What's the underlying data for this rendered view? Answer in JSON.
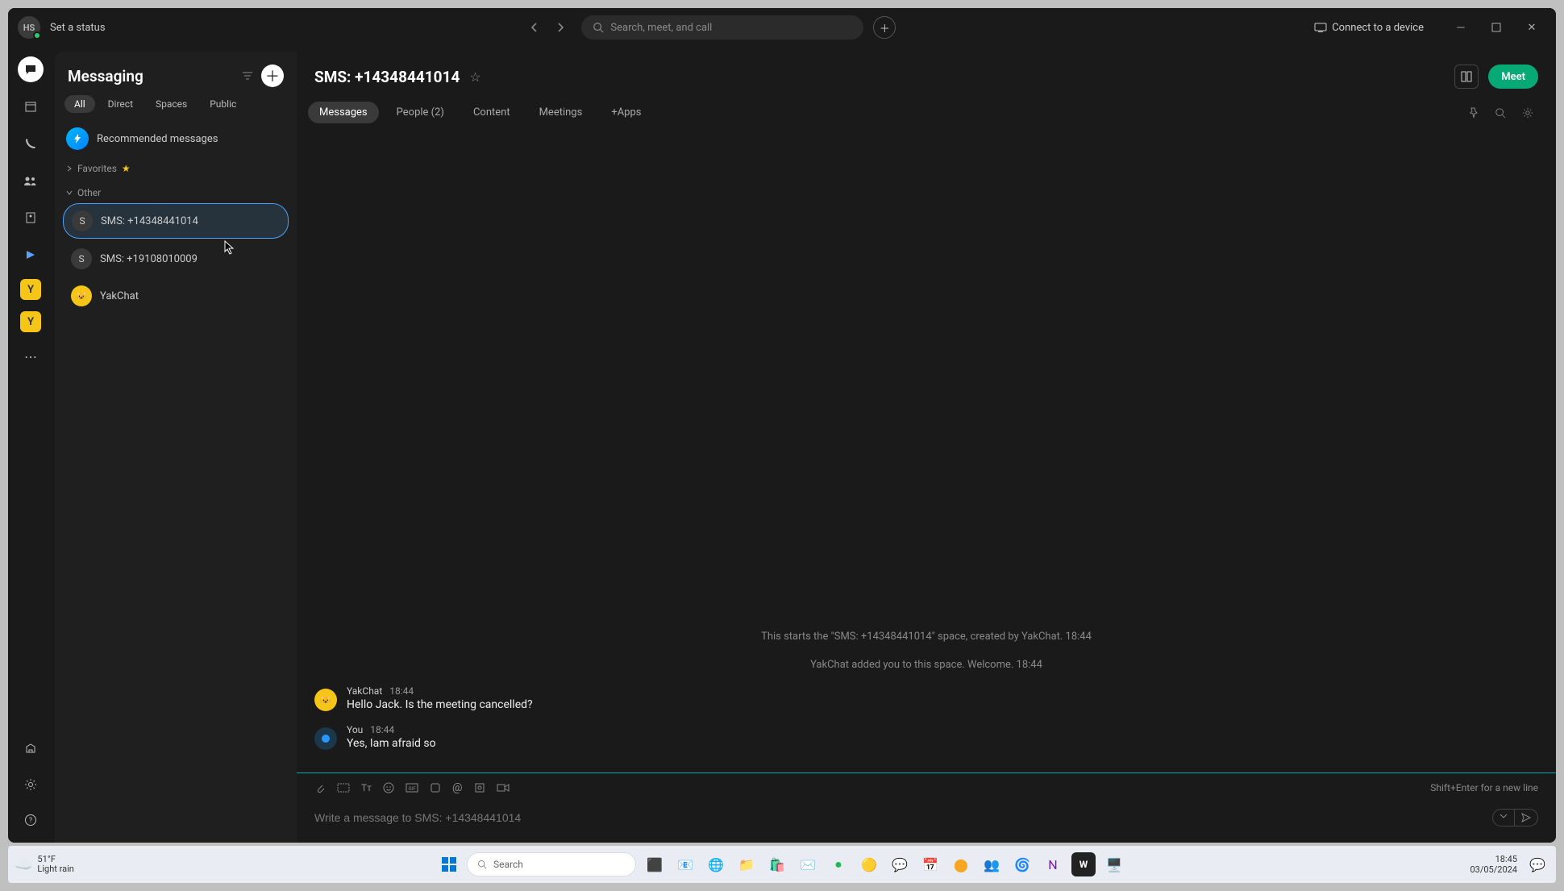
{
  "titlebar": {
    "avatar_initials": "HS",
    "status_prompt": "Set a status",
    "search_placeholder": "Search, meet, and call",
    "connect_label": "Connect to a device"
  },
  "sidebar": {
    "title": "Messaging",
    "tabs": [
      "All",
      "Direct",
      "Spaces",
      "Public"
    ],
    "active_tab_index": 0,
    "recommended_label": "Recommended messages",
    "sections": {
      "favorites_label": "Favorites",
      "other_label": "Other"
    },
    "conversations": [
      {
        "avatar": "S",
        "label": "SMS: +14348441014",
        "selected": true,
        "type": "sms"
      },
      {
        "avatar": "S",
        "label": "SMS: +19108010009",
        "selected": false,
        "type": "sms"
      },
      {
        "avatar": "Y",
        "label": "YakChat",
        "selected": false,
        "type": "yak"
      }
    ]
  },
  "main": {
    "title": "SMS: +14348441014",
    "meet_label": "Meet",
    "tabs": [
      {
        "label": "Messages",
        "active": true
      },
      {
        "label": "People (2)",
        "active": false
      },
      {
        "label": "Content",
        "active": false
      },
      {
        "label": "Meetings",
        "active": false
      },
      {
        "label": "+Apps",
        "active": false
      }
    ],
    "system_messages": [
      "This starts the \"SMS: +14348441014\" space, created by YakChat. 18:44",
      "YakChat added you to this space. Welcome. 18:44"
    ],
    "messages": [
      {
        "sender": "YakChat",
        "time": "18:44",
        "text": "Hello Jack. Is the meeting cancelled?",
        "avatar_type": "yak"
      },
      {
        "sender": "You",
        "time": "18:44",
        "text": "Yes, Iam afraid so",
        "avatar_type": "you"
      }
    ],
    "composer": {
      "hint": "Shift+Enter for a new line",
      "placeholder": "Write a message to SMS: +14348441014"
    }
  },
  "taskbar": {
    "weather_temp": "51°F",
    "weather_desc": "Light rain",
    "search_placeholder": "Search",
    "time": "18:45",
    "date": "03/05/2024"
  }
}
